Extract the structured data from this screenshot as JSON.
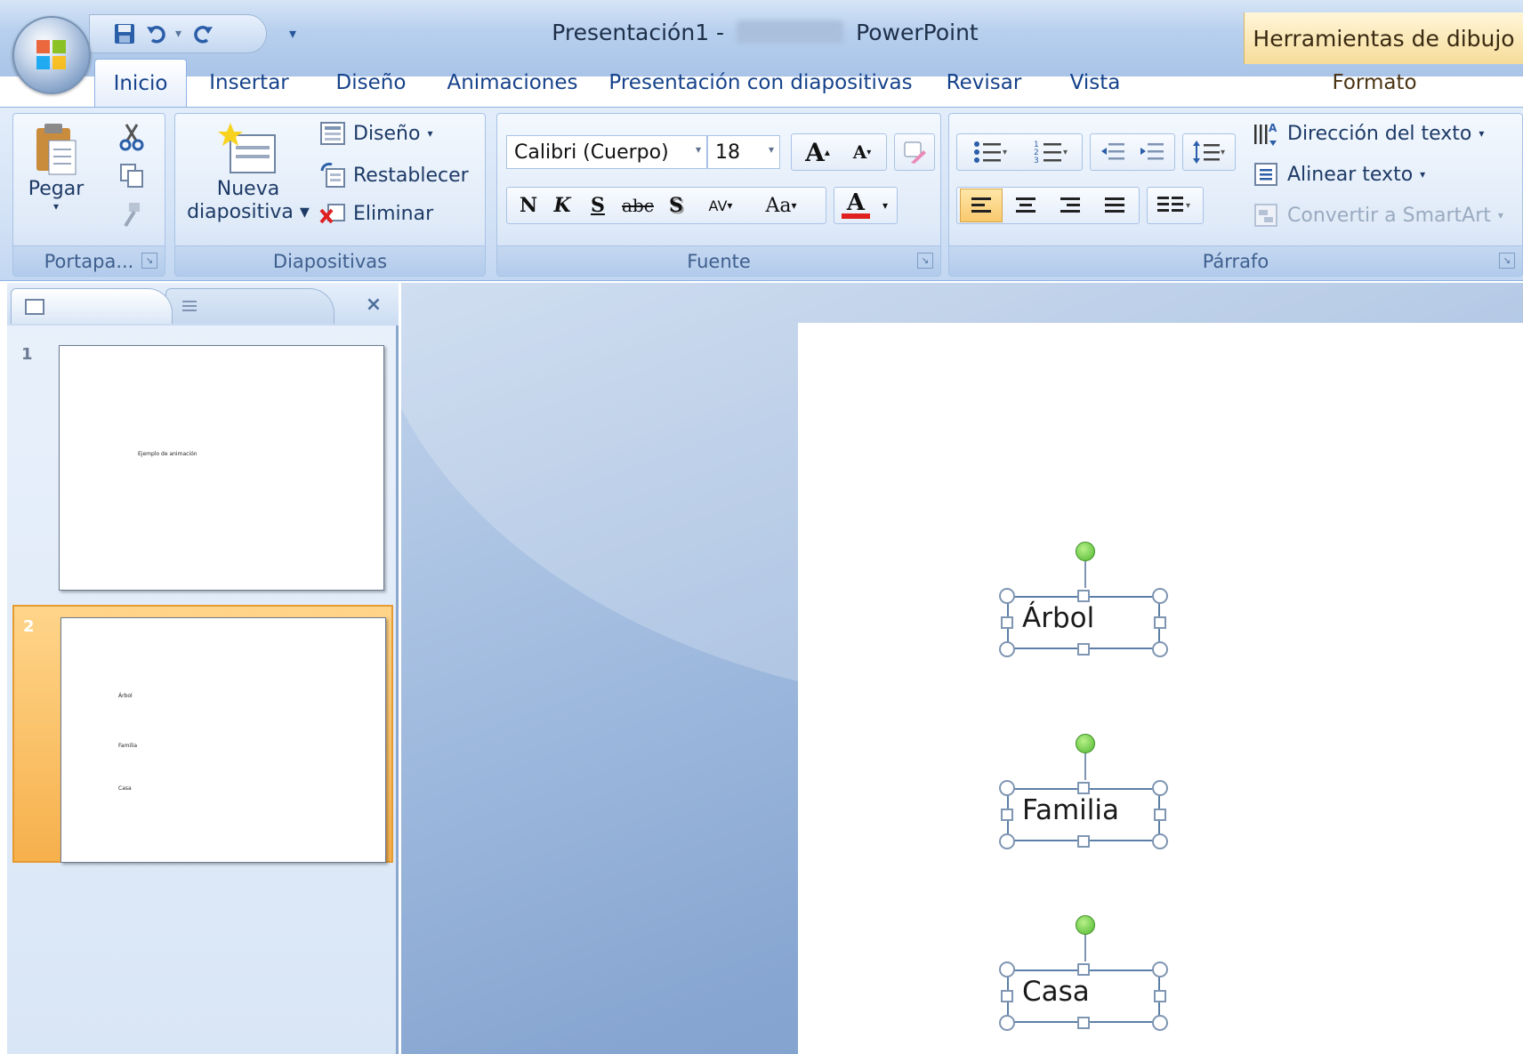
{
  "window": {
    "title_doc": "Presentación1 -",
    "title_app": "PowerPoint",
    "contextual_header": "Herramientas de dibujo"
  },
  "qat": {
    "save_icon": "save-icon",
    "undo_icon": "undo-icon",
    "redo_icon": "redo-icon",
    "customize_icon": "customize-qat-icon"
  },
  "tabs": [
    {
      "label": "Inicio",
      "active": true
    },
    {
      "label": "Insertar"
    },
    {
      "label": "Diseño"
    },
    {
      "label": "Animaciones"
    },
    {
      "label": "Presentación con diapositivas"
    },
    {
      "label": "Revisar"
    },
    {
      "label": "Vista"
    },
    {
      "label": "Formato",
      "contextual": true
    }
  ],
  "ribbon": {
    "portapapeles": {
      "label": "Portapa...",
      "paste": "Pegar"
    },
    "diapositivas": {
      "label": "Diapositivas",
      "new_slide_1": "Nueva",
      "new_slide_2": "diapositiva",
      "layout": "Diseño",
      "reset": "Restablecer",
      "delete": "Eliminar"
    },
    "fuente": {
      "label": "Fuente",
      "font_name": "Calibri (Cuerpo)",
      "font_size": "18",
      "grow": "A",
      "shrink": "A",
      "bold": "N",
      "italic": "K",
      "underline": "S",
      "strike": "abc",
      "shadow": "S",
      "spacing": "AV",
      "case": "Aa",
      "color": "A",
      "font_color": "#e02020"
    },
    "parrafo": {
      "label": "Párrafo",
      "text_direction": "Dirección del texto",
      "align_text": "Alinear texto",
      "smartart": "Convertir a SmartArt"
    }
  },
  "slides_panel": {
    "slides": [
      {
        "number": "1",
        "texts": [
          "Ejemplo de animación"
        ]
      },
      {
        "number": "2",
        "texts": [
          "Árbol",
          "Familia",
          "Casa"
        ],
        "selected": true
      }
    ]
  },
  "slide": {
    "shapes": [
      {
        "text": "Árbol"
      },
      {
        "text": "Familia"
      },
      {
        "text": "Casa"
      }
    ]
  },
  "colors": {
    "ribbon_blue": "#d4e3f6",
    "selection_orange": "#f6b04c",
    "rotation_green": "#4fb82f"
  }
}
